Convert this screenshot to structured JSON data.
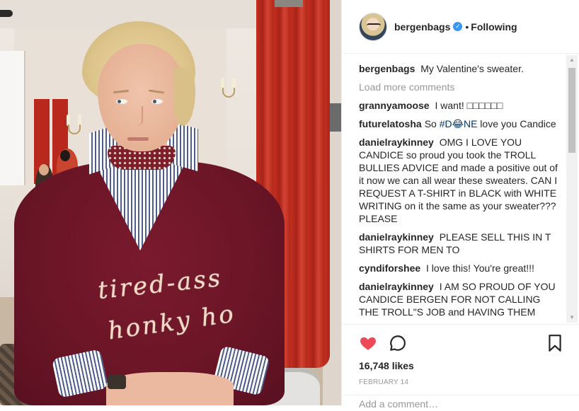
{
  "post": {
    "username": "bergenbags",
    "follow_state": "Following",
    "dot": "•",
    "verified_glyph": "✓",
    "caption": "My Valentine's sweater.",
    "load_more": "Load more comments",
    "comments": [
      {
        "user": "grannyamoose",
        "text": "I want! □□□□□□"
      },
      {
        "user": "futurelatosha",
        "text_before": "So ",
        "hashtag": "#D😂NE",
        "text_after": " love you Candice"
      },
      {
        "user": "danielraykinney",
        "text": "OMG I LOVE YOU CANDICE so proud you took the TROLL BULLIES ADVICE and made a positive out of it now we can all wear these sweaters. CAN I REQUEST A T-SHIRT in BLACK with WHITE WRITING on it the same as your sweater??? PLEASE"
      },
      {
        "user": "danielraykinney",
        "text": "PLEASE SELL THIS IN T SHIRTS FOR MEN TO"
      },
      {
        "user": "cyndiforshee",
        "text": "I love this! You're great!!!"
      },
      {
        "user": "danielraykinney",
        "text": "I AM SO PROUD OF YOU CANDICE BERGEN FOR NOT CALLING THE TROLL\"S JOB and HAVING THEM FIRED for calling you a HONKEY +HO"
      }
    ],
    "likes": "16,748 likes",
    "date": "FEBRUARY 14",
    "add_comment_placeholder": "Add a comment…"
  },
  "photo": {
    "sweater_text_line1": "tired-ass",
    "sweater_text_line2": "honky ho"
  },
  "scrollbar": {
    "up_glyph": "▲",
    "down_glyph": "▼"
  },
  "colors": {
    "heart": "#ed4956",
    "link_blue": "#003569",
    "verified": "#3897f0",
    "muted": "#999999",
    "sweater": "#6a1526",
    "curtain": "#c3301f"
  },
  "icons": [
    "heart-icon",
    "comment-icon",
    "bookmark-icon",
    "verified-icon"
  ]
}
